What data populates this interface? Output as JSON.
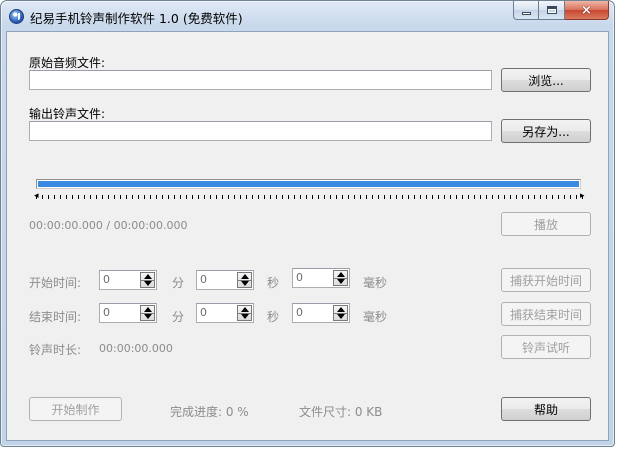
{
  "window": {
    "title": "纪易手机铃声制作软件 1.0 (免费软件)",
    "close_glyph": "×"
  },
  "source": {
    "label": "原始音频文件:",
    "value": "",
    "browse_label": "浏览..."
  },
  "output": {
    "label": "输出铃声文件:",
    "value": "",
    "save_as_label": "另存为..."
  },
  "playback": {
    "progress": 1.0,
    "time_readout": "00:00:00.000 / 00:00:00.000",
    "play_label": "播放"
  },
  "start_time": {
    "label": "开始时间:",
    "minutes": "0",
    "minutes_unit": "分",
    "seconds": "0",
    "seconds_unit": "秒",
    "millis": "0",
    "millis_unit": "毫秒",
    "capture_label": "捕获开始时间"
  },
  "end_time": {
    "label": "结束时间:",
    "minutes": "0",
    "minutes_unit": "分",
    "seconds": "0",
    "seconds_unit": "秒",
    "millis": "0",
    "millis_unit": "毫秒",
    "capture_label": "捕获结束时间"
  },
  "duration": {
    "label": "铃声时长:",
    "value": "00:00:00.000",
    "preview_label": "铃声试听"
  },
  "footer": {
    "start_label": "开始制作",
    "progress_text": "完成进度: 0 %",
    "size_text": "文件尺寸: 0 KB",
    "help_label": "帮助"
  },
  "icons": {
    "app": "music-note-icon",
    "minimize": "minimize-icon",
    "maximize": "maximize-icon",
    "close": "close-icon"
  },
  "colors": {
    "progress_fill": "#3a8be0",
    "disabled_text": "#8c8c8c"
  }
}
